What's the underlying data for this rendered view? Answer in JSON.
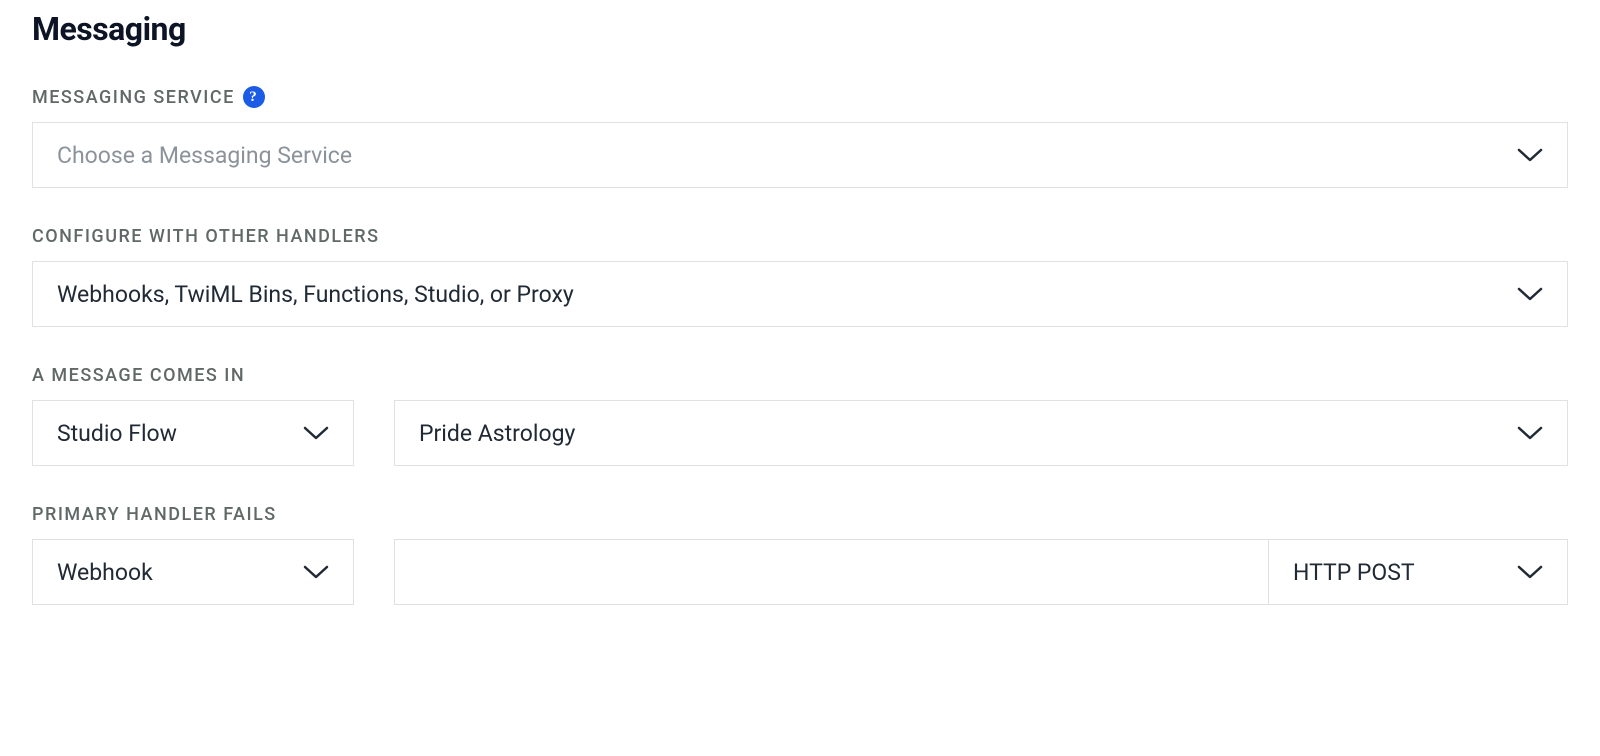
{
  "section": {
    "title": "Messaging"
  },
  "fields": {
    "messaging_service": {
      "label": "MESSAGING SERVICE",
      "placeholder": "Choose a Messaging Service",
      "value": ""
    },
    "configure_handlers": {
      "label": "CONFIGURE WITH OTHER HANDLERS",
      "value": "Webhooks, TwiML Bins, Functions, Studio, or Proxy"
    },
    "message_comes_in": {
      "label": "A MESSAGE COMES IN",
      "handler_type": "Studio Flow",
      "handler_value": "Pride Astrology"
    },
    "primary_handler_fails": {
      "label": "PRIMARY HANDLER FAILS",
      "handler_type": "Webhook",
      "url_value": "",
      "http_method": "HTTP POST"
    }
  }
}
